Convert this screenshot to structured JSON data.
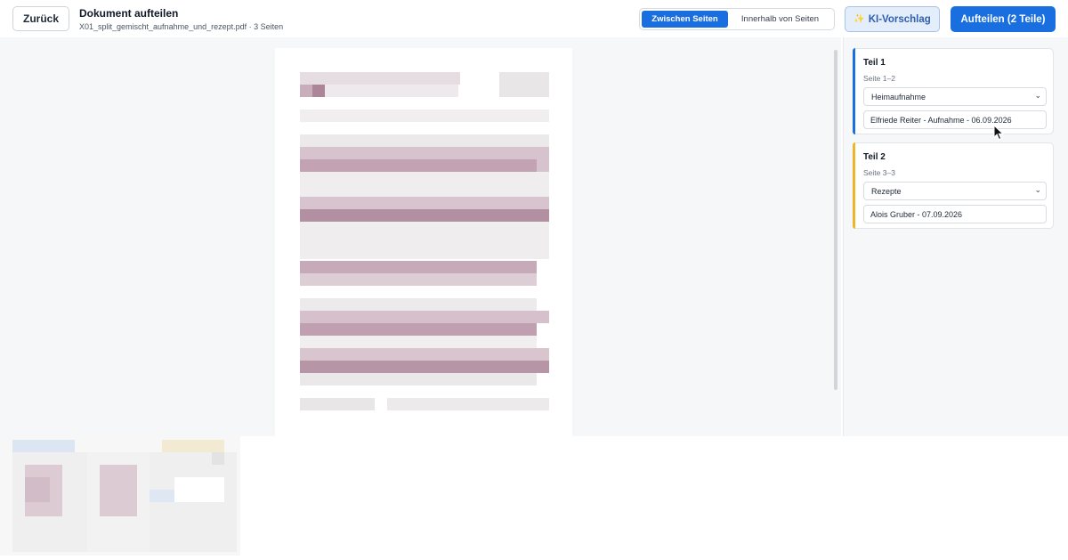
{
  "header": {
    "back_label": "Zurück",
    "title": "Dokument aufteilen",
    "subtitle": "X01_split_gemischt_aufnahme_und_rezept.pdf · 3 Seiten",
    "mode_options": [
      "Zwischen Seiten",
      "Innerhalb von Seiten"
    ],
    "active_mode": "Zwischen Seiten",
    "ki_label": "KI-Vorschlag",
    "split_label": "Aufteilen (2 Teile)"
  },
  "parts": [
    {
      "title": "Teil 1",
      "range": "Seite 1–2",
      "category": "Heimaufnahme",
      "name": "Elfriede Reiter - Aufnahme - 06.09.2026",
      "accent": "#1a6fe0"
    },
    {
      "title": "Teil 2",
      "range": "Seite 3–3",
      "category": "Rezepte",
      "name": "Alois Gruber - 07.09.2026",
      "accent": "#f0b429"
    }
  ],
  "icons": {
    "ki": "sparkle-icon",
    "dropdown": "chevron-down-icon",
    "pointer": "mouse-cursor-icon"
  }
}
